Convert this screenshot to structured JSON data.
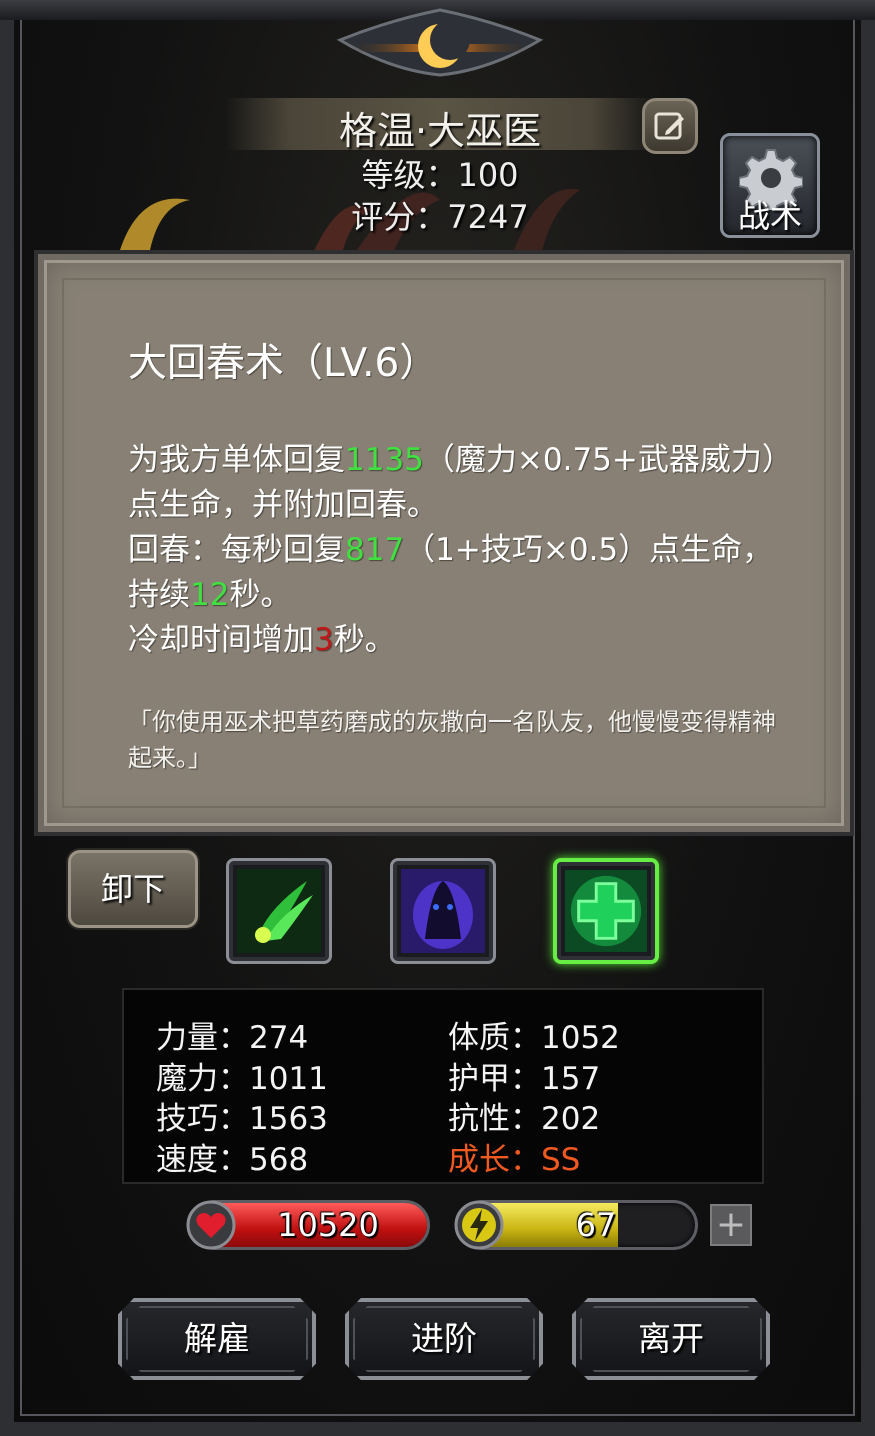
{
  "hero": {
    "name": "格温·大巫医",
    "level_text": "等级：100",
    "score_text": "评分：7247"
  },
  "tactics_button": {
    "label": "战术",
    "icon": "gear-icon"
  },
  "edit_button": {
    "icon": "edit-icon"
  },
  "skill": {
    "title": "大回春术（LV.6）",
    "line1_a": "为我方单体回复",
    "heal_value": "1135",
    "line1_b": "（魔力×0.75+武器威力）点生命，并附加回春。",
    "line2_a": "回春：每秒回复",
    "regen_value": "817",
    "line2_b": "（1+技巧×0.5）点生命，持续",
    "duration_value": "12",
    "line2_c": "秒。",
    "line3_a": "冷却时间增加",
    "cooldown_value": "3",
    "line3_b": "秒。",
    "flavor": "「你使用巫术把草药磨成的灰撒向一名队友，他慢慢变得精神起来。」"
  },
  "unequip_button": {
    "label": "卸下"
  },
  "skill_slots": [
    {
      "icon": "green-claw-icon",
      "selected": false
    },
    {
      "icon": "shadow-beast-icon",
      "selected": false
    },
    {
      "icon": "green-cross-icon",
      "selected": true
    }
  ],
  "attributes": {
    "strength": "力量：274",
    "magic": "魔力：1011",
    "skill": "技巧：1563",
    "speed": "速度：568",
    "constitution": "体质：1052",
    "armor": "护甲：157",
    "resistance": "抗性：202",
    "growth": "成长：SS"
  },
  "hp_bar": {
    "value": "10520",
    "fill_fraction": 1.0,
    "color": "#d42020",
    "icon": "heart-icon"
  },
  "energy_bar": {
    "value": "67",
    "fill_fraction": 0.67,
    "color": "#d8c814",
    "icon": "lightning-icon"
  },
  "plus_button": {
    "label": "+"
  },
  "actions": {
    "dismiss": "解雇",
    "advance": "进阶",
    "leave": "离开"
  }
}
